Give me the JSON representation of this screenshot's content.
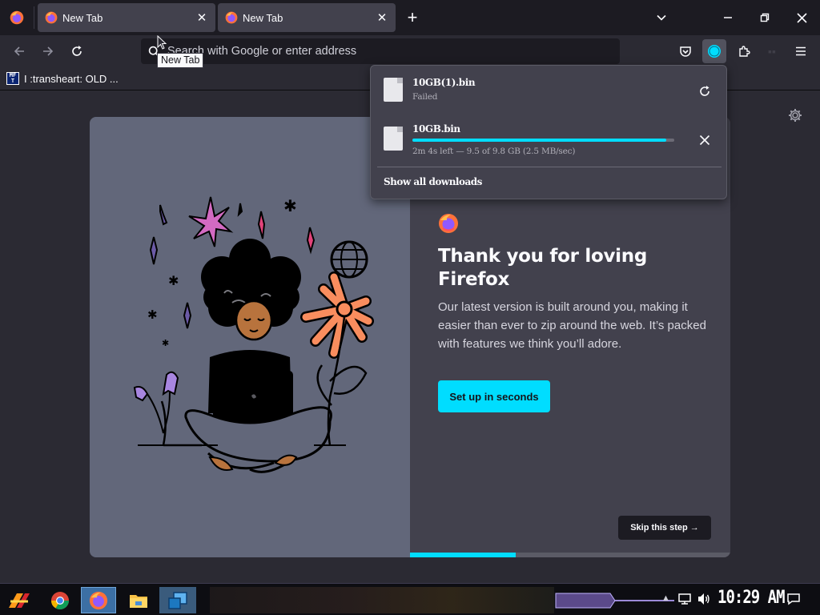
{
  "tabs": [
    {
      "label": "New Tab",
      "active": false
    },
    {
      "label": "New Tab",
      "active": true
    }
  ],
  "tooltip": "New Tab",
  "urlbar": {
    "placeholder": "Search with Google or enter address"
  },
  "bookmarks": [
    {
      "label": "I :transheart: OLD ...",
      "icon_text": "MF T"
    }
  ],
  "downloads": {
    "items": [
      {
        "name": "10GB(1).bin",
        "status": "Failed",
        "action": "retry-icon"
      },
      {
        "name": "10GB.bin",
        "status": "2m 4s left — 9.5 of 9.8 GB (2.5 MB/sec)",
        "progress": 0.969,
        "action": "cancel-icon"
      }
    ],
    "show_all": "Show all downloads"
  },
  "welcome": {
    "headline": "Thank you for loving Firefox",
    "body": "Our latest version is built around you, making it easier than ever to zip around the web. It’s packed with features we think you’ll adore.",
    "primary_button": "Set up in seconds",
    "skip_button": "Skip this step →",
    "step_progress": 0.33
  },
  "taskbar": {
    "clock": "10:29 AM"
  },
  "colors": {
    "accent": "#00ddff",
    "toolbar": "#2b2a33",
    "tabstrip": "#1c1b22",
    "card": "#42414d",
    "illustration_bg": "#62677a"
  }
}
